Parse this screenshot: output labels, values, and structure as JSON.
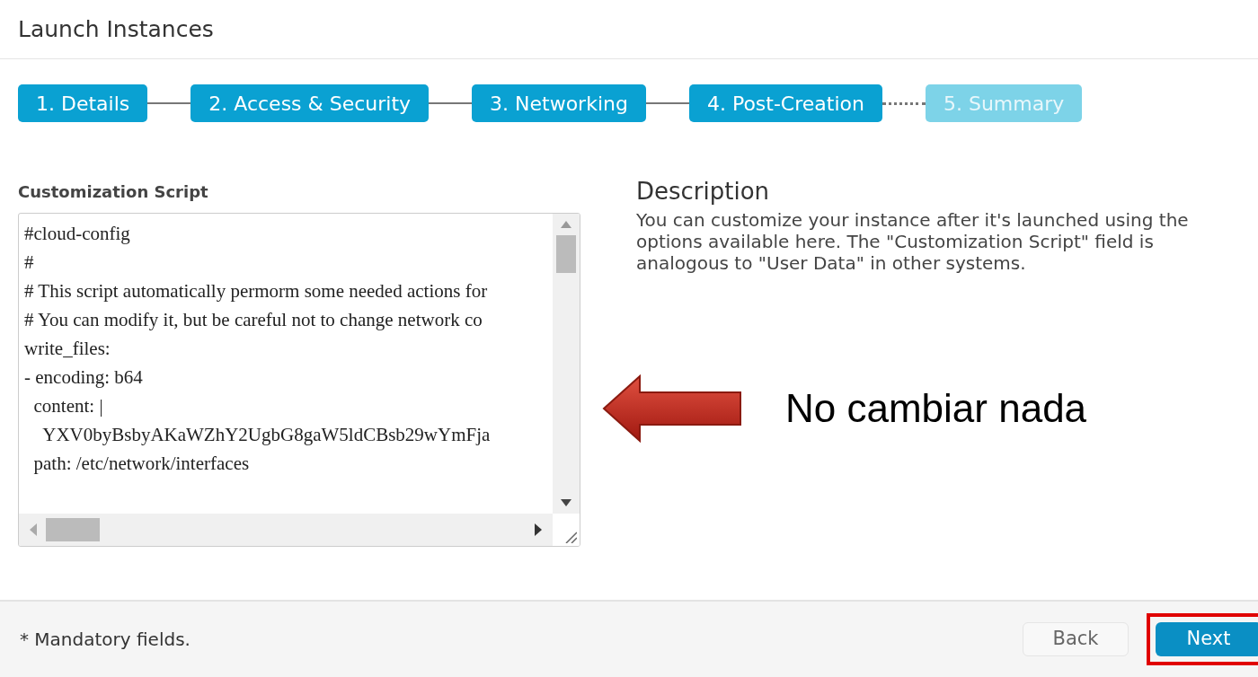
{
  "window": {
    "title": "Launch Instances"
  },
  "steps": [
    {
      "label": "1. Details",
      "done": true
    },
    {
      "label": "2. Access & Security",
      "done": true
    },
    {
      "label": "3. Networking",
      "done": true
    },
    {
      "label": "4. Post-Creation",
      "done": true
    },
    {
      "label": "5. Summary",
      "done": false
    }
  ],
  "script_field": {
    "label": "Customization Script",
    "lines": [
      "#cloud-config",
      "#",
      "# This script automatically permorm some needed actions for",
      "# You can modify it, but be careful not to change network co",
      "write_files:",
      "- encoding: b64",
      "  content: |",
      "    YXV0byBsbyAKaWZhY2UgbG8gaW5ldCBsb29wYmFja",
      "  path: /etc/network/interfaces"
    ]
  },
  "description": {
    "title": "Description",
    "text": "You can customize your instance after it's launched using the options available here. The \"Customization Script\" field is analogous to \"User Data\" in other systems."
  },
  "annotation": {
    "text": "No cambiar nada"
  },
  "footer": {
    "note": "* Mandatory fields.",
    "buttons": [
      {
        "label": "Back",
        "kind": "secondary",
        "highlighted": false
      },
      {
        "label": "Next",
        "kind": "primary",
        "highlighted": true
      }
    ]
  }
}
